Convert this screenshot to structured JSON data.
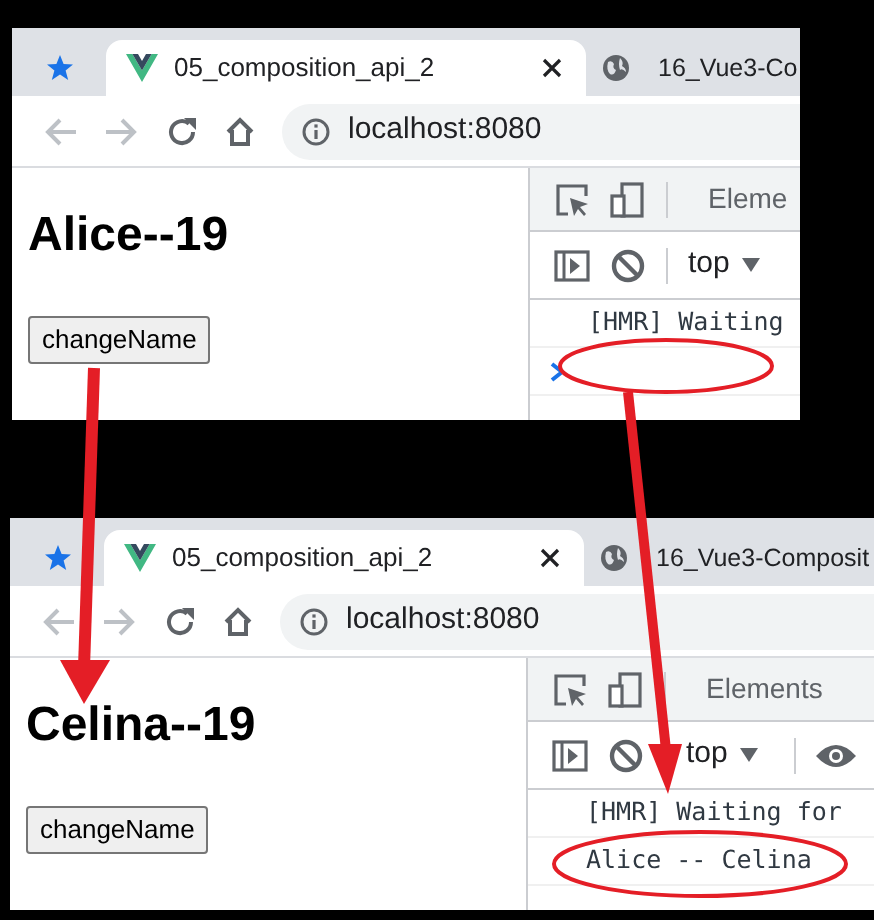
{
  "screenshots": [
    {
      "tabs": [
        {
          "kind": "pinned",
          "selected": false
        },
        {
          "kind": "vue",
          "label": "05_composition_api_2",
          "selected": true
        },
        {
          "kind": "globe",
          "label": "16_Vue3-Co",
          "selected": false
        }
      ],
      "address": "localhost:8080",
      "heading": "Alice--19",
      "button": "changeName",
      "devtools": {
        "panel_tab": "Eleme",
        "context": "top",
        "eye": false,
        "console": [
          {
            "kind": "log",
            "text": "[HMR] Waiting"
          },
          {
            "kind": "prompt"
          }
        ]
      }
    },
    {
      "tabs": [
        {
          "kind": "pinned",
          "selected": false
        },
        {
          "kind": "vue",
          "label": "05_composition_api_2",
          "selected": true
        },
        {
          "kind": "globe",
          "label": "16_Vue3-Composit",
          "selected": false
        }
      ],
      "address": "localhost:8080",
      "heading": "Celina--19",
      "button": "changeName",
      "devtools": {
        "panel_tab": "Elements",
        "context": "top",
        "eye": true,
        "console": [
          {
            "kind": "log",
            "text": "[HMR] Waiting for"
          },
          {
            "kind": "log",
            "text": "Alice -- Celina"
          }
        ]
      }
    }
  ]
}
